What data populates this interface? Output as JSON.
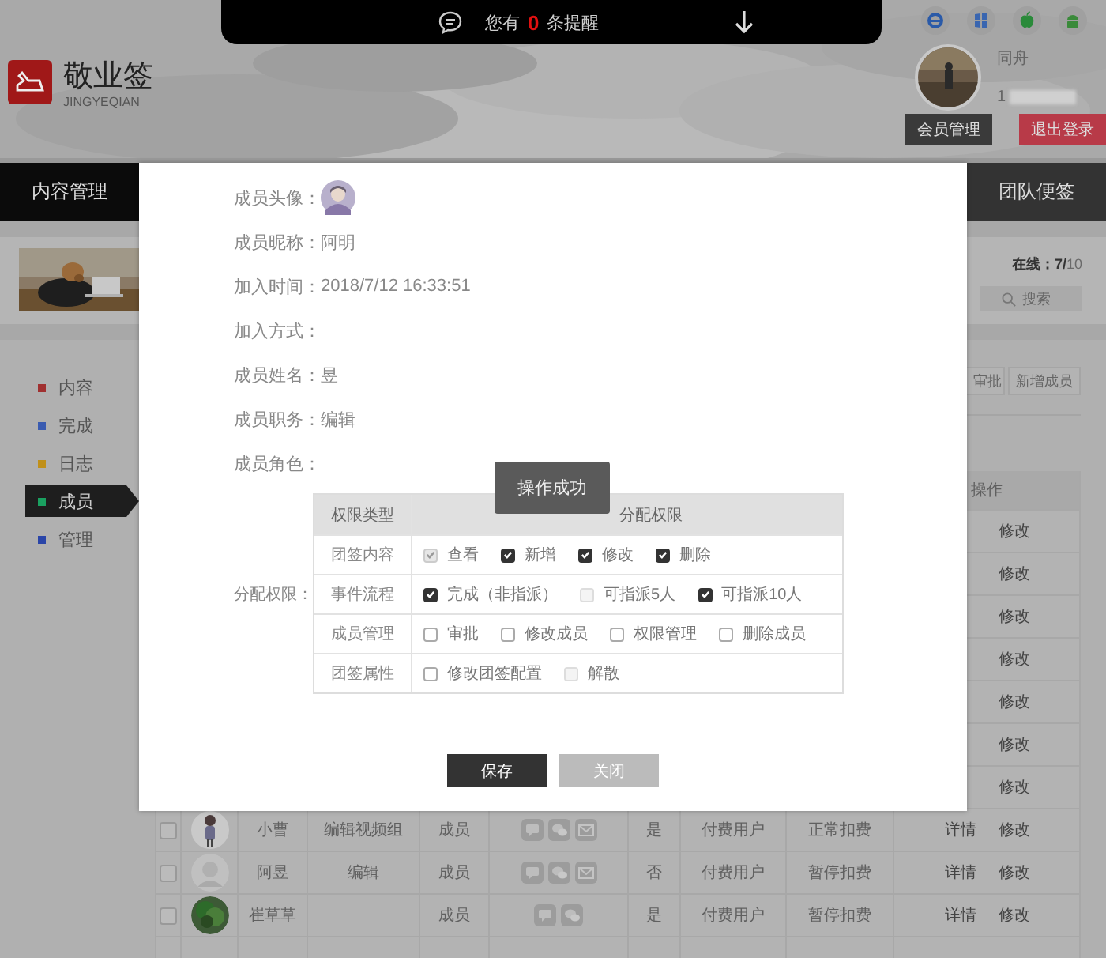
{
  "notification": {
    "prefix": "您有",
    "count": "0",
    "suffix": "条提醒"
  },
  "header": {
    "logo_title": "敬业签",
    "logo_subtitle": "JINGYEQIAN",
    "user_name": "同舟",
    "user_phone": "1",
    "buttons": [
      {
        "label": "会员管理",
        "kind": "dark"
      },
      {
        "label": "退出登录",
        "kind": "red"
      }
    ]
  },
  "nav": [
    {
      "label": "内容管理",
      "selected": false
    },
    {
      "label": "团队便签",
      "selected": true
    }
  ],
  "online": {
    "label": "在线：7/",
    "total": "10"
  },
  "search": {
    "placeholder": "搜索"
  },
  "sidebar": [
    {
      "label": "内容",
      "color": "#a03030",
      "selected": false
    },
    {
      "label": "完成",
      "color": "#3a5bb0",
      "selected": false
    },
    {
      "label": "日志",
      "color": "#c0901a",
      "selected": false
    },
    {
      "label": "成员",
      "color": "#1aa060",
      "selected": true
    },
    {
      "label": "管理",
      "color": "#2a45a8",
      "selected": false
    }
  ],
  "actions": [
    "审批",
    "新增成员"
  ],
  "table": {
    "action_header": "操作",
    "rows": [
      {
        "kind": "partial",
        "actions": [
          "修改"
        ]
      },
      {
        "kind": "partial",
        "actions": [
          "修改"
        ]
      },
      {
        "kind": "partial",
        "actions": [
          "修改"
        ]
      },
      {
        "kind": "partial",
        "actions": [
          "修改"
        ]
      },
      {
        "kind": "partial",
        "actions": [
          "修改"
        ]
      },
      {
        "kind": "partial",
        "actions": [
          "修改"
        ]
      },
      {
        "kind": "partial",
        "actions": [
          "修改"
        ]
      },
      {
        "kind": "full",
        "checked": false,
        "name": "小曹",
        "group": "编辑视频组",
        "role": "成员",
        "contacts": [
          {
            "kind": "chat"
          },
          {
            "kind": "wechat"
          },
          {
            "kind": "mail"
          }
        ],
        "flag": "是",
        "user_type": "付费用户",
        "billing": "正常扣费",
        "actions": [
          "详情",
          "修改"
        ]
      },
      {
        "kind": "full",
        "checked": false,
        "name": "阿昱",
        "group": "编辑",
        "role": "成员",
        "contacts": [
          {
            "kind": "chat"
          },
          {
            "kind": "wechat"
          },
          {
            "kind": "mail"
          }
        ],
        "flag": "否",
        "user_type": "付费用户",
        "billing": "暂停扣费",
        "actions": [
          "详情",
          "修改"
        ]
      },
      {
        "kind": "full",
        "checked": false,
        "name": "崔草草",
        "role": "成员",
        "contacts": [
          {
            "kind": "chat"
          },
          {
            "kind": "wechat"
          }
        ],
        "flag": "是",
        "user_type": "付费用户",
        "billing": "暂停扣费",
        "actions": [
          "详情",
          "修改"
        ]
      },
      {
        "kind": "empty"
      }
    ]
  },
  "modal": {
    "fields": [
      {
        "label": "成员头像：",
        "kind": "avatar"
      },
      {
        "label": "成员昵称：",
        "value": "阿明",
        "kind": "text"
      },
      {
        "label": "加入时间：",
        "value": "2018/7/12 16:33:51",
        "kind": "text"
      },
      {
        "label": "加入方式：",
        "kind": "text"
      },
      {
        "label": "成员姓名：",
        "value": "昱",
        "kind": "text"
      },
      {
        "label": "成员职务：",
        "value": "编辑",
        "kind": "text"
      },
      {
        "label": "成员角色：",
        "kind": "text"
      }
    ],
    "permissions": {
      "label": "分配权限：",
      "headers": [
        "权限类型",
        "分配权限"
      ],
      "rows": [
        {
          "type": "团签内容",
          "options": [
            {
              "label": "查看",
              "checked": true,
              "disabled": true
            },
            {
              "label": "新增",
              "checked": true,
              "disabled": false
            },
            {
              "label": "修改",
              "checked": true,
              "disabled": false
            },
            {
              "label": "删除",
              "checked": true,
              "disabled": false
            }
          ]
        },
        {
          "type": "事件流程",
          "options": [
            {
              "label": "完成（非指派）",
              "checked": true,
              "disabled": false
            },
            {
              "label": "可指派5人",
              "checked": false,
              "disabled": true
            },
            {
              "label": "可指派10人",
              "checked": true,
              "disabled": false
            }
          ]
        },
        {
          "type": "成员管理",
          "options": [
            {
              "label": "审批",
              "checked": false,
              "disabled": false
            },
            {
              "label": "修改成员",
              "checked": false,
              "disabled": false
            },
            {
              "label": "权限管理",
              "checked": false,
              "disabled": false
            },
            {
              "label": "删除成员",
              "checked": false,
              "disabled": false
            }
          ]
        },
        {
          "type": "团签属性",
          "options": [
            {
              "label": "修改团签配置",
              "checked": false,
              "disabled": false
            },
            {
              "label": "解散",
              "checked": false,
              "disabled": true
            }
          ]
        }
      ]
    },
    "buttons": [
      {
        "label": "保存",
        "kind": "primary"
      },
      {
        "label": "关闭",
        "kind": "secondary"
      }
    ]
  },
  "toast": "操作成功"
}
